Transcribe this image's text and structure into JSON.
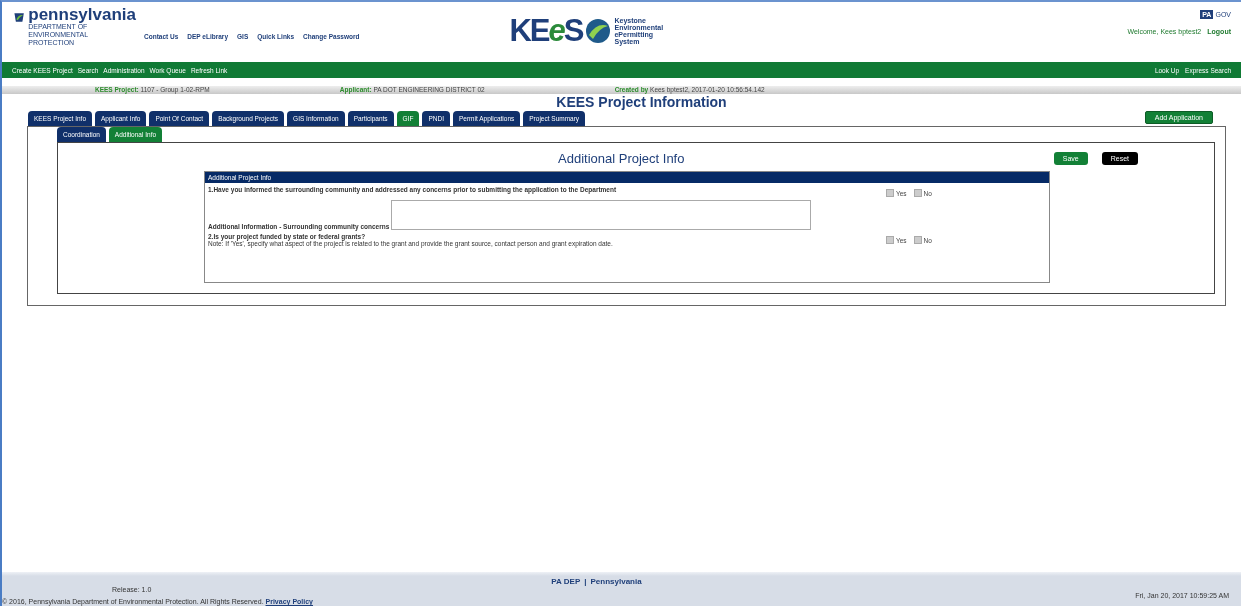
{
  "header": {
    "agency": {
      "name": "pennsylvania",
      "subtitle": "DEPARTMENT OF ENVIRONMENTAL PROTECTION"
    },
    "top_links": [
      "Contact Us",
      "DEP eLibrary",
      "GIS",
      "Quick Links",
      "Change Password"
    ],
    "kees_logo": {
      "wordmark": [
        {
          "text": "KE",
          "kind": "plain"
        },
        {
          "text": "e",
          "kind": "accent"
        },
        {
          "text": "S",
          "kind": "plain"
        }
      ],
      "tagline": [
        "Keystone",
        "Environmental",
        "ePermitting",
        "System"
      ]
    },
    "pa_gov": {
      "badge": "PA",
      "text": "GOV"
    },
    "welcome": "Welcome, Kees bptest2",
    "logout": "Logout"
  },
  "nav": {
    "left": [
      "Create KEES Project",
      "Search",
      "Administration",
      "Work Queue",
      "Refresh Link"
    ],
    "right": [
      "Look Up",
      "Express Search"
    ]
  },
  "info_bar": [
    {
      "label": "KEES Project:",
      "value": "1107 - Group 1-02-RPM"
    },
    {
      "label": "Applicant:",
      "value": "PA DOT ENGINEERING DISTRICT 02"
    },
    {
      "label": "Created by",
      "value": "Kees bptest2, 2017-01-20 10:56:54.142"
    }
  ],
  "page_title": "KEES Project Information",
  "tabs": [
    {
      "label": "KEES Project Info",
      "selected": false
    },
    {
      "label": "Applicant Info",
      "selected": false
    },
    {
      "label": "Point Of Contact",
      "selected": false
    },
    {
      "label": "Background Projects",
      "selected": false
    },
    {
      "label": "GIS Information",
      "selected": false
    },
    {
      "label": "Participants",
      "selected": false
    },
    {
      "label": "GIF",
      "selected": true
    },
    {
      "label": "PNDI",
      "selected": false
    },
    {
      "label": "Permit Applications",
      "selected": false
    },
    {
      "label": "Project Summary",
      "selected": false
    }
  ],
  "add_button": "Add Application",
  "sub_tabs": [
    {
      "label": "Coordination",
      "selected": false
    },
    {
      "label": "Additional Info",
      "selected": true
    }
  ],
  "section_title": "Additional Project Info",
  "form_buttons": [
    {
      "label": "Save",
      "kind": "primary"
    },
    {
      "label": "Reset",
      "kind": "secondary"
    }
  ],
  "panel": {
    "header": "Additional Project Info",
    "rows": [
      {
        "kind": "yesno",
        "question": "1.Have you informed the surrounding community and addressed any concerns prior to submitting the application to the Department",
        "options": [
          {
            "label": "Yes",
            "checked": false
          },
          {
            "label": "No",
            "checked": false
          }
        ]
      },
      {
        "kind": "text",
        "label": "Additional Information - Surrounding community concerns"
      },
      {
        "kind": "yesno",
        "question": "2.Is your project funded by state or federal grants?",
        "note": "Note: If 'Yes', specify what aspect of the project is related to the grant and provide the grant source, contact person and grant expiration date.",
        "options": [
          {
            "label": "Yes",
            "checked": false
          },
          {
            "label": "No",
            "checked": false
          }
        ]
      }
    ]
  },
  "footer": {
    "links": [
      "PA DEP",
      "Pennsylvania"
    ],
    "separator": "|",
    "release": "Release: 1.0",
    "copyright": "© 2016, Pennsylvania Department of Environmental Protection. All Rights Reserved.",
    "privacy": "Privacy Policy",
    "timestamp": "Fri, Jan 20, 2017 10:59:25 AM"
  }
}
